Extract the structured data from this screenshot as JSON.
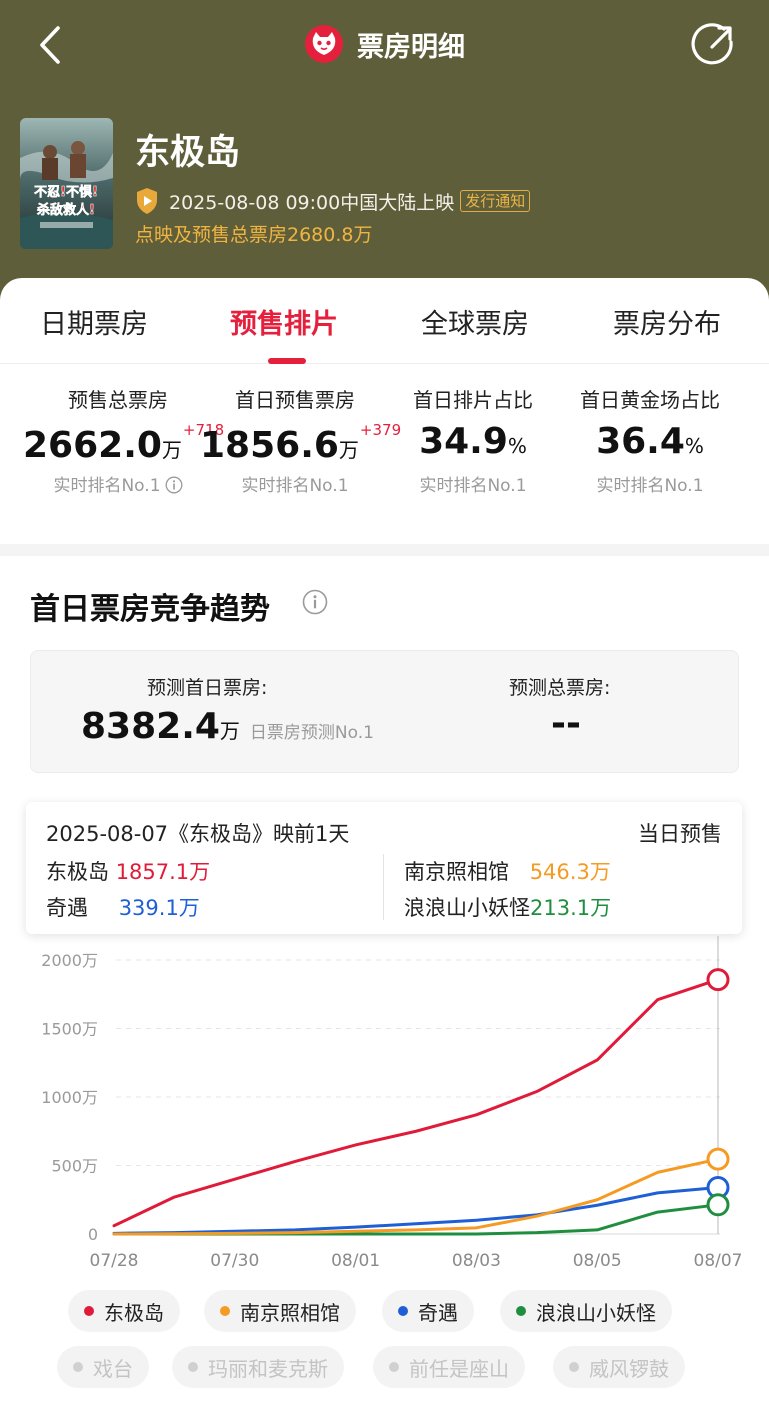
{
  "nav": {
    "title": "票房明细"
  },
  "movie": {
    "title": "东极岛",
    "poster_text": "不忍!不惧!杀敌救人!",
    "release": "2025-08-08 09:00中国大陆上映",
    "release_tag": "发行通知",
    "presale_total": "点映及预售总票房2680.8万"
  },
  "tabs": [
    {
      "label": "日期票房",
      "active": false
    },
    {
      "label": "预售排片",
      "active": true
    },
    {
      "label": "全球票房",
      "active": false
    },
    {
      "label": "票房分布",
      "active": false
    }
  ],
  "stats": [
    {
      "label": "预售总票房",
      "value": "2662.0",
      "unit": "万",
      "delta": "+718",
      "rank": "实时排名No.1"
    },
    {
      "label": "首日预售票房",
      "value": "1856.6",
      "unit": "万",
      "delta": "+379",
      "rank": "实时排名No.1"
    },
    {
      "label": "首日排片占比",
      "value": "34.9",
      "unit": "%",
      "delta": "",
      "rank": "实时排名No.1"
    },
    {
      "label": "首日黄金场占比",
      "value": "36.4",
      "unit": "%",
      "delta": "",
      "rank": "实时排名No.1"
    }
  ],
  "section": {
    "title": "首日票房竞争趋势"
  },
  "prediction": {
    "first_day_label": "预测首日票房:",
    "first_day_value": "8382.4",
    "first_day_unit": "万",
    "first_day_rank": "日票房预测No.1",
    "total_label": "预测总票房:",
    "total_value": "--"
  },
  "tooltip": {
    "date": "2025-08-07《东极岛》映前1天",
    "type": "当日预售",
    "items": [
      {
        "name": "东极岛",
        "value": "1857.1万"
      },
      {
        "name": "南京照相馆",
        "value": "546.3万"
      },
      {
        "name": "奇遇",
        "value": "339.1万"
      },
      {
        "name": "浪浪山小妖怪",
        "value": "213.1万"
      }
    ]
  },
  "colors": {
    "header_bg": "#5f5e3a",
    "accent": "#e4203d",
    "gold": "#f0b541",
    "series_red": "#e01b3a",
    "series_orange": "#f59a23",
    "series_blue": "#1e5fd6",
    "series_green": "#1f8f3f"
  },
  "chart_data": {
    "type": "line",
    "x": [
      "07/28",
      "07/29",
      "07/30",
      "07/31",
      "08/01",
      "08/02",
      "08/03",
      "08/04",
      "08/05",
      "08/06",
      "08/07"
    ],
    "x_tick_labels": [
      "07/28",
      "07/30",
      "08/01",
      "08/03",
      "08/05",
      "08/07"
    ],
    "y_tick_labels": [
      "0",
      "500万",
      "1000万",
      "1500万",
      "2000万"
    ],
    "ylim": [
      0,
      2000
    ],
    "grid": true,
    "series": [
      {
        "name": "东极岛",
        "color": "#e01b3a",
        "values": [
          60,
          270,
          400,
          530,
          650,
          750,
          870,
          1040,
          1270,
          1710,
          1857.1
        ]
      },
      {
        "name": "南京照相馆",
        "color": "#f59a23",
        "values": [
          0,
          2,
          5,
          10,
          20,
          30,
          45,
          130,
          250,
          450,
          546.3
        ]
      },
      {
        "name": "奇遇",
        "color": "#1e5fd6",
        "values": [
          5,
          10,
          20,
          30,
          50,
          75,
          100,
          140,
          210,
          300,
          339.1
        ]
      },
      {
        "name": "浪浪山小妖怪",
        "color": "#1f8f3f",
        "values": [
          0,
          0,
          0,
          0,
          0,
          0,
          0,
          10,
          30,
          160,
          213.1
        ]
      }
    ],
    "legend": [
      {
        "name": "东极岛",
        "active": true,
        "color": "#e01b3a"
      },
      {
        "name": "南京照相馆",
        "active": true,
        "color": "#f59a23"
      },
      {
        "name": "奇遇",
        "active": true,
        "color": "#1e5fd6"
      },
      {
        "name": "浪浪山小妖怪",
        "active": true,
        "color": "#1f8f3f"
      },
      {
        "name": "戏台",
        "active": false,
        "color": "#d0d0d0"
      },
      {
        "name": "玛丽和麦克斯",
        "active": false,
        "color": "#d0d0d0"
      },
      {
        "name": "前任是座山",
        "active": false,
        "color": "#d0d0d0"
      },
      {
        "name": "威风锣鼓",
        "active": false,
        "color": "#d0d0d0"
      }
    ]
  }
}
